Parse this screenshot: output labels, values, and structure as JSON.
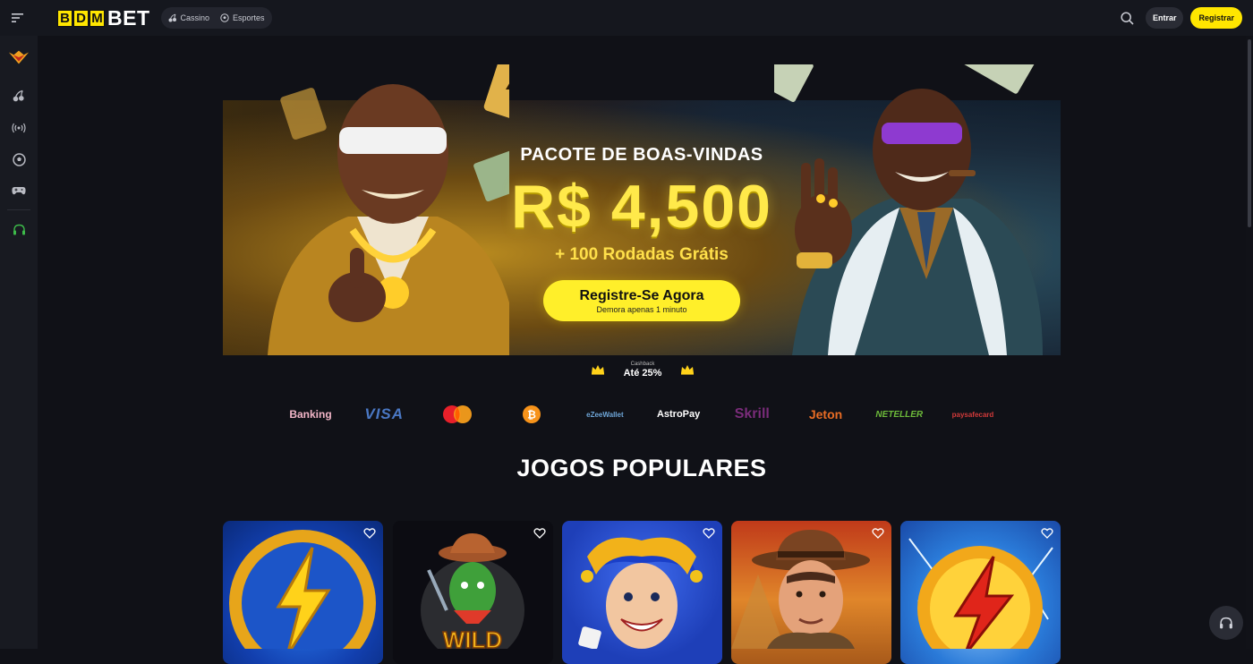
{
  "header": {
    "logo": {
      "letters": [
        "B",
        "D",
        "M"
      ],
      "suffix": "BET"
    },
    "nav": [
      {
        "label": "Cassino",
        "icon": "cherry-icon"
      },
      {
        "label": "Esportes",
        "icon": "soccer-ball-icon"
      }
    ],
    "login_label": "Entrar",
    "register_label": "Registrar"
  },
  "sidebar": {
    "items": [
      {
        "icon": "vip-crown-badge-icon"
      },
      {
        "icon": "cherry-icon"
      },
      {
        "icon": "live-broadcast-icon"
      },
      {
        "icon": "soccer-ball-icon"
      },
      {
        "icon": "gamepad-icon"
      },
      {
        "icon": "headset-icon"
      }
    ]
  },
  "hero": {
    "subtitle": "PACOTE DE BOAS-VINDAS",
    "amount": "R$ 4,500",
    "bonus": "+ 100 Rodadas Grátis",
    "cta_label": "Registre-Se Agora",
    "cta_sub": "Demora apenas 1 minuto"
  },
  "cashback": {
    "label": "Cashback",
    "value": "Até 25%"
  },
  "payments": [
    "Banking",
    "VISA",
    "mastercard",
    "bitcoin",
    "eZeeWallet",
    "AstroPay",
    "Skrill",
    "Jeton",
    "NETELLER",
    "paysafecard"
  ],
  "section": {
    "title": "JOGOS POPULARES"
  },
  "games": [
    {
      "icon": "lightning-coin-icon",
      "bg": "#1a4fd8"
    },
    {
      "icon": "cactus-cowboy-icon",
      "bg": "#0c0c12",
      "text": "WILD"
    },
    {
      "icon": "jester-icon",
      "bg": "#2a4fd6"
    },
    {
      "icon": "explorer-icon",
      "bg": "#d8581a"
    },
    {
      "icon": "red-lightning-coin-icon",
      "bg": "#2a78d8"
    }
  ],
  "colors": {
    "accent": "#ffe600",
    "background": "#101117",
    "topbar": "#15171e",
    "sidebar": "#181a21"
  }
}
